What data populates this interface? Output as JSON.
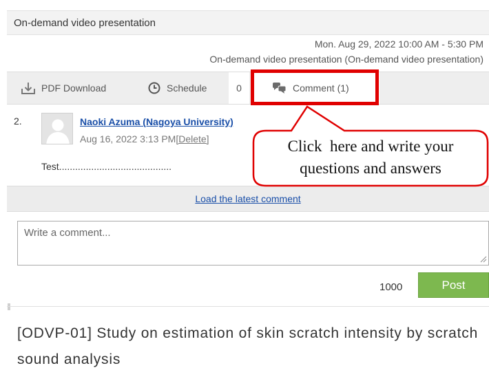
{
  "header": {
    "title": "On-demand video presentation"
  },
  "session": {
    "date_time": "Mon. Aug 29, 2022 10:00 AM - 5:30 PM",
    "type": "On-demand video presentation (On-demand video presentation)"
  },
  "toolbar": {
    "pdf_label": "PDF Download",
    "schedule_label": "Schedule",
    "schedule_count": "0",
    "comment_label": "Comment (1)"
  },
  "comment": {
    "number": "2.",
    "author": "Naoki Azuma (Nagoya University)",
    "date": "Aug 16, 2022 3:13 PM",
    "delete_label": "[Delete]",
    "text": "Test.........................................."
  },
  "load_latest_label": "Load the latest comment",
  "input": {
    "placeholder": "Write a comment..."
  },
  "char_limit": "1000",
  "post_label": "Post",
  "paper_title": "[ODVP-01] Study on estimation of skin scratch intensity by scratch sound analysis",
  "annotation": {
    "line1": "Click  here and write your",
    "line2": "questions and answers"
  },
  "colors": {
    "accent_red": "#e00000",
    "post_green": "#7db84f",
    "link_blue": "#1a4fa8"
  },
  "icons": [
    "pdf-download-icon",
    "clock-icon",
    "comment-bubbles-icon",
    "avatar-placeholder-icon"
  ]
}
